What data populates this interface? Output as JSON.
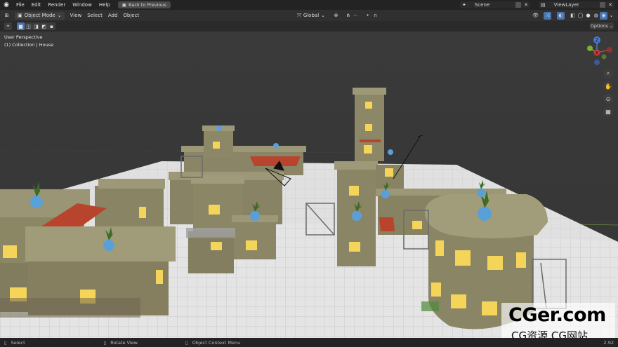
{
  "topbar": {
    "menus": [
      "File",
      "Edit",
      "Render",
      "Window",
      "Help"
    ],
    "back_button": "Back to Previous",
    "scene": "Scene",
    "view_layer": "ViewLayer"
  },
  "header": {
    "mode": "Object Mode",
    "menus": [
      "View",
      "Select",
      "Add",
      "Object"
    ],
    "orientation": "Global"
  },
  "viewport": {
    "perspective_label": "User Perspective",
    "collection_label": "(1) Collection | House",
    "options_label": "Options",
    "gizmo": {
      "z": "Z",
      "y": "Y",
      "x": "X"
    }
  },
  "statusbar": {
    "select": "Select",
    "rotate": "Rotate View",
    "context_menu": "Object Context Menu",
    "version": "2.92"
  },
  "watermark": {
    "main": "CGer.com",
    "sub": "CG资源  CG网站"
  },
  "colors": {
    "accent": "#4772b3",
    "window_glow": "#f5d45a",
    "wall": "#8d8a6a",
    "roof_red": "#b8442e",
    "floor": "#dcdcdc"
  }
}
